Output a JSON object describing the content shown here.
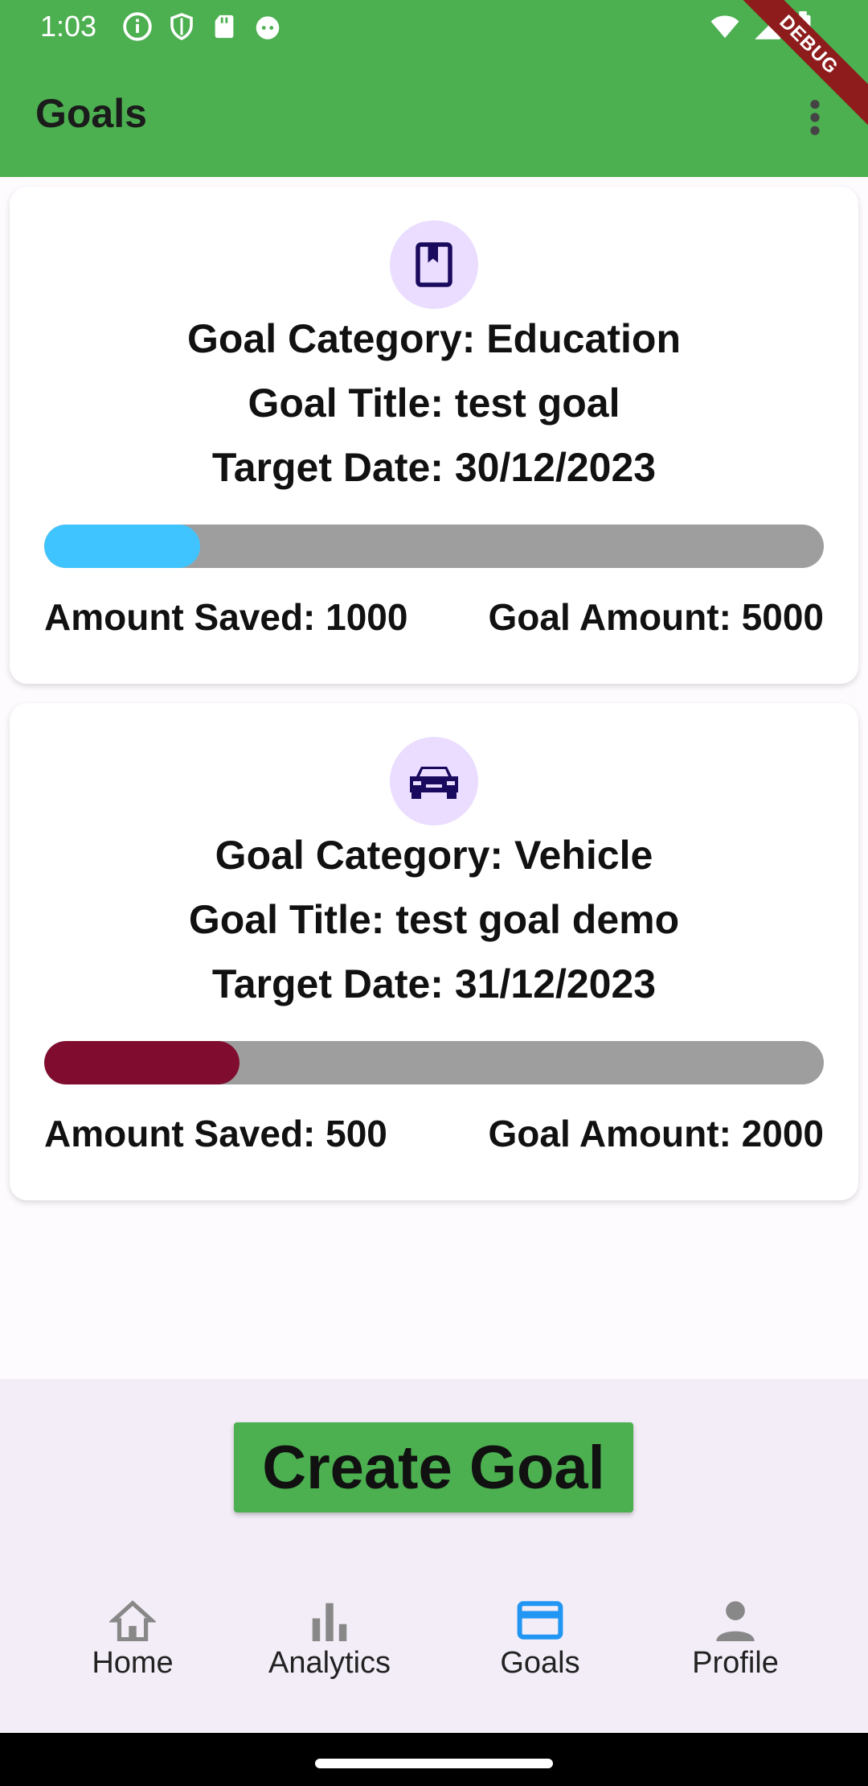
{
  "status_bar": {
    "time": "1:03"
  },
  "app_bar": {
    "title": "Goals",
    "debug_label": "DEBUG"
  },
  "goals": [
    {
      "category_line": "Goal Category: Education",
      "title_line": "Goal Title: test goal",
      "date_line": "Target Date: 30/12/2023",
      "saved_line": "Amount Saved: 1000",
      "goal_line": "Goal Amount: 5000",
      "progress": 0.2,
      "progress_color": "#40c4ff",
      "icon": "book-icon"
    },
    {
      "category_line": "Goal Category: Vehicle",
      "title_line": "Goal Title: test goal demo",
      "date_line": "Target Date: 31/12/2023",
      "saved_line": "Amount Saved: 500",
      "goal_line": "Goal Amount: 2000",
      "progress": 0.25,
      "progress_color": "#800d30",
      "icon": "car-icon"
    }
  ],
  "create_button": {
    "label": "Create Goal"
  },
  "bottom_nav": {
    "items": [
      {
        "label": "Home",
        "icon": "home-icon"
      },
      {
        "label": "Analytics",
        "icon": "bar-chart-icon"
      },
      {
        "label": "Goals",
        "icon": "card-icon",
        "active": true
      },
      {
        "label": "Profile",
        "icon": "person-icon"
      }
    ],
    "active_color": "#2196f3",
    "inactive_color": "#888888"
  },
  "colors": {
    "app_bar": "#4caf50",
    "icon_bg": "#eaddff",
    "icon_fg": "#1a0a5e"
  }
}
